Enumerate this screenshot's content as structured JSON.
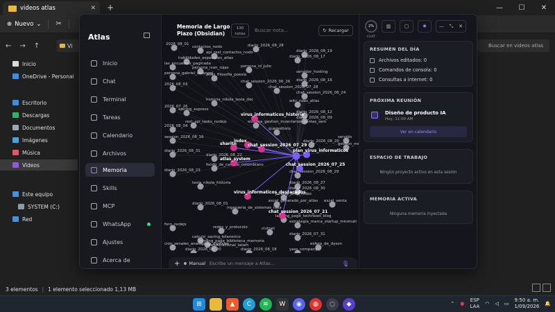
{
  "explorer": {
    "tab_title": "videos atlas",
    "new_button": "Nuevo",
    "path_label": "Vi",
    "search_placeholder": "Buscar en videos atlas",
    "sidebar": [
      "Inicio",
      "OneDrive - Personal",
      "Escritorio",
      "Descargas",
      "Documentos",
      "Imágenes",
      "Música",
      "Videos",
      "Este equipo",
      "SYSTEM (C:)",
      "Red"
    ],
    "status_items": "3 elementos",
    "status_selected": "1 elemento seleccionado  1,13 MB"
  },
  "taskbar": {
    "lang": "ESP",
    "lang_sub": "LAA",
    "time": "9:50 a. m.",
    "date": "1/09/2026"
  },
  "atlas": {
    "logo": "Atlas",
    "nav": [
      "Inicio",
      "Chat",
      "Terminal",
      "Tareas",
      "Calendario",
      "Archivos",
      "Memoria",
      "Skills",
      "MCP",
      "WhatsApp",
      "Ajustes",
      "Acerca de"
    ],
    "memory_title": "Memoria de Largo Plazo (Obsidian)",
    "notes_count": "130",
    "notes_label": "notas",
    "search_placeholder": "Buscar nota...",
    "reload_label": "Recargar",
    "composer_mode": "Manual",
    "composer_placeholder": "Escribe un mensaje a Atlas...",
    "chat_pct": "2%",
    "chat_label": "CHAT",
    "summary": {
      "title": "RESUMEN DEL DÍA",
      "rows": [
        "Archivos editados: 0",
        "Comandos de consola: 0",
        "Consultas a internet: 0"
      ]
    },
    "meeting": {
      "title": "PRÓXIMA REUNIÓN",
      "event": "Diseño de producto IA",
      "when": "Hoy, 11:00 AM",
      "button": "Ver en calendario"
    },
    "workspace": {
      "title": "ESPACIO DE TRABAJO",
      "empty": "Ningún proyecto activo en esta sesión"
    },
    "active_memory": {
      "title": "MEMORIA ACTIVA",
      "empty": "Ninguna memoria inyectada"
    }
  },
  "graph_labels": {
    "grey": [
      "2026_08_01",
      "contactos_nodo",
      "diario_2026_08_28",
      "api_rest_contactos_nodo",
      "diario_2026_08_19",
      "diario_2026_08_17",
      "habilidades_especiales_atlas",
      "las_encuestas_paginada",
      "persona_ivan_rojas",
      "persona_id_julio",
      "servidor_hosting",
      "persona_gabriel_arcangel",
      "atlas_filosofia_poesia",
      "chat_session_2026_06_26",
      "diario_2026_08_16",
      "2026_08_03",
      "chat_session_2026_07_28",
      "chat_session_2026_08_24",
      "historia_nikola_tesla_doc",
      "wiki_rules_atlas",
      "2026_07_26",
      "ejerrog_express",
      "diario_2026_08_12",
      "diario_2026_08_09",
      "rest_api_tasks_nodejs",
      "sistema_gestion_inventarios_ventas_sem",
      "2026_08_04",
      "querestions",
      "session_2026_08_16",
      "diario_2026_08_20",
      "servido",
      "gestion_mensuales",
      "diario_2026_08_31",
      "diario_2026_08_22",
      "fondo_de_cambio_colombiano",
      "diario_2026_08_23",
      "chat_session_2026_08_29",
      "tesla_nikola_historia",
      "diario_2026_08_27",
      "diario_2026_08_30",
      "piratas_pma_redes",
      "excel_generado_por_atlas",
      "excel_venta",
      "diario_2026_08_01",
      "ingenieria_de_sistemas_idea",
      "landing_page_technews_blog",
      "estrategia_marca_startup_minimali",
      "foro_nodejs",
      "redes_y_protocolo",
      "clutnet",
      "calculo_saving_bilanerico",
      "landing_page_biblioteca_memoria",
      "diario_2026_07_31",
      "cion_senales_analogicas_digitales",
      "comunicacional_latam",
      "esfera_de_dyson",
      "diario_2026_08_20",
      "yass_company",
      "diario_2026_08_18"
    ],
    "highlight": [
      "virus_informaticos_historia",
      "index",
      "sharitn",
      "chat_session_2026_07_29",
      "plan_virus_informaticos",
      "atlas_system",
      "chat_session_2026_07_25",
      "virus_informaticos_destacados",
      "chat_session_2026_07_21"
    ]
  }
}
